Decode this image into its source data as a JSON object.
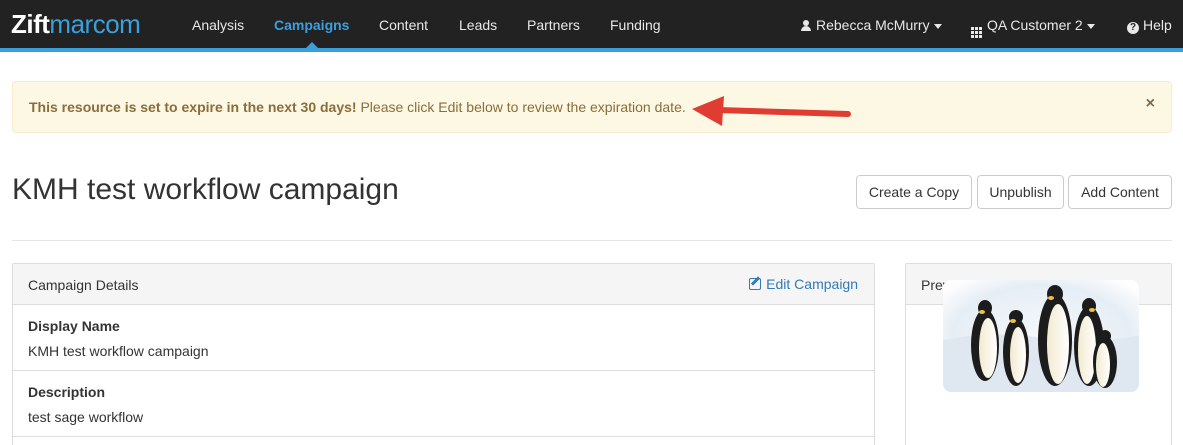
{
  "nav": {
    "logo_bold": "Zift",
    "logo_regular": "marcom",
    "items": [
      {
        "label": "Analysis"
      },
      {
        "label": "Campaigns"
      },
      {
        "label": "Content"
      },
      {
        "label": "Leads"
      },
      {
        "label": "Partners"
      },
      {
        "label": "Funding"
      }
    ],
    "active_item": "Campaigns",
    "user_name": "Rebecca McMurry",
    "account_name": "QA Customer 2",
    "help_label": "Help"
  },
  "alert": {
    "bold_text": "This resource is set to expire in the next 30 days!",
    "text": " Please click Edit below to review the expiration date.",
    "close_symbol": "×"
  },
  "page": {
    "title": "KMH test workflow campaign",
    "actions": {
      "create_copy": "Create a Copy",
      "unpublish": "Unpublish",
      "add_content": "Add Content"
    }
  },
  "details": {
    "heading": "Campaign Details",
    "edit_label": "Edit Campaign",
    "fields": [
      {
        "label": "Display Name",
        "value": "KMH test workflow campaign"
      },
      {
        "label": "Description",
        "value": "test sage workflow"
      }
    ]
  },
  "preview": {
    "heading": "Preview Image",
    "image_subject": "emperor penguins"
  },
  "colors": {
    "nav_bg": "#222222",
    "accent": "#3aa0dc",
    "alert_bg": "#fcf8e3",
    "alert_text": "#8a6d3b",
    "link": "#337ab7",
    "annotation_arrow": "#e03c31"
  }
}
